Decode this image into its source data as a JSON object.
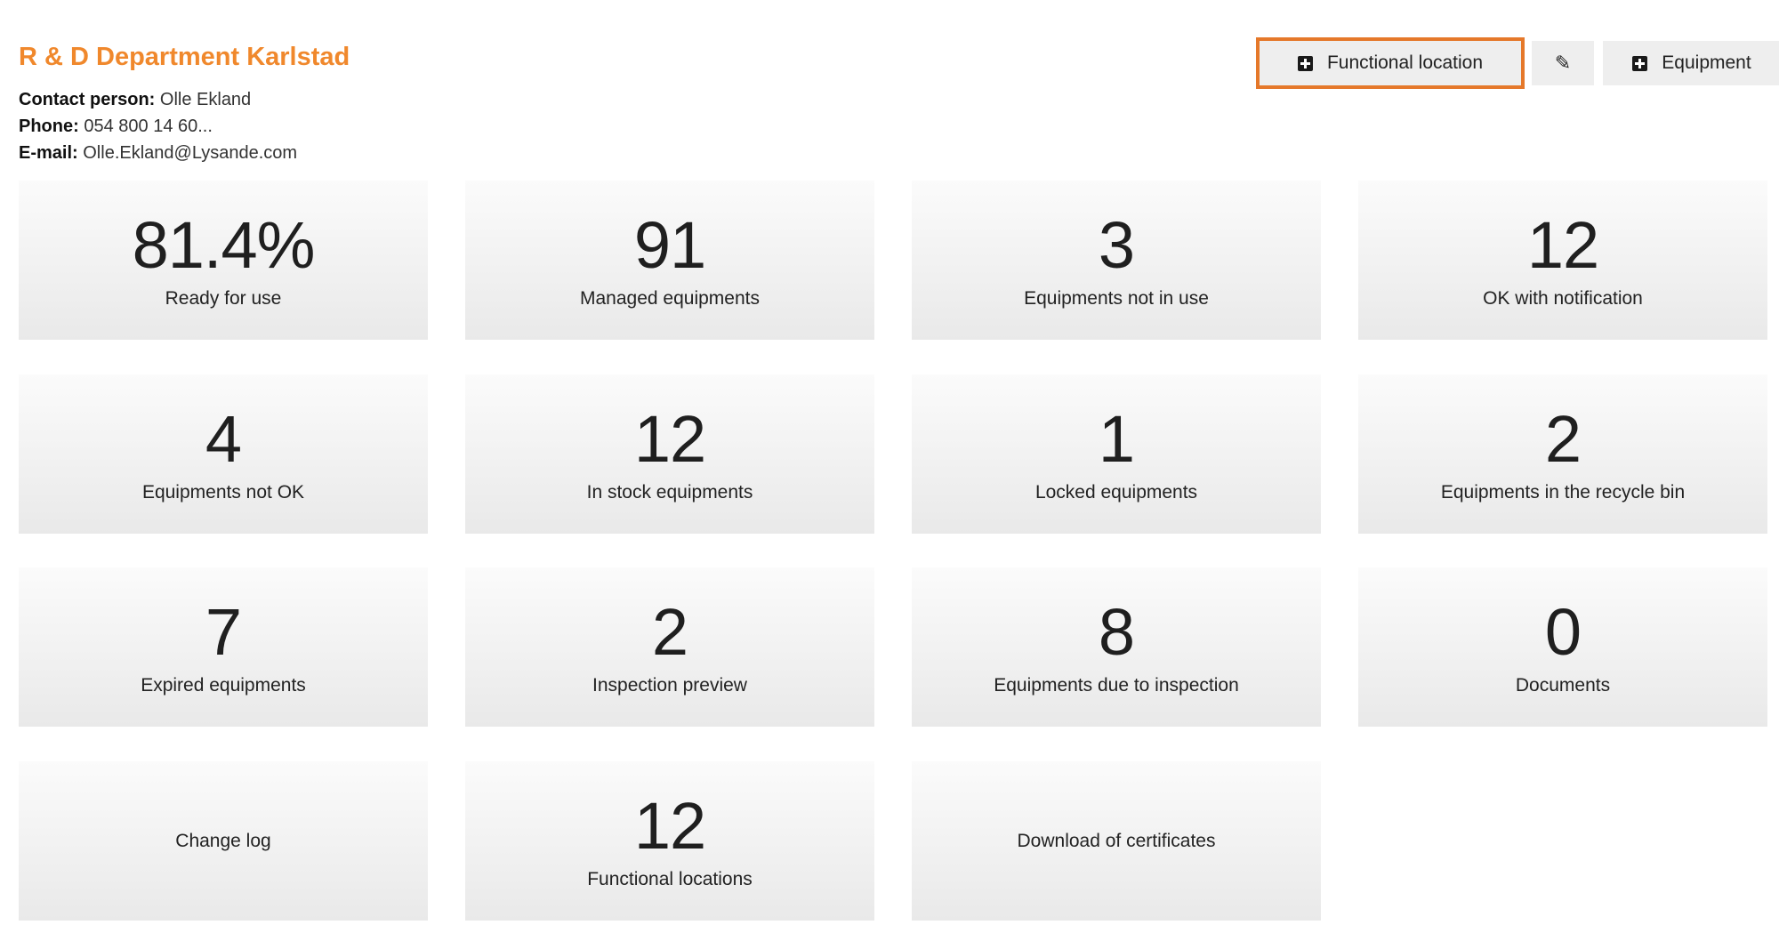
{
  "header": {
    "title": "R & D Department Karlstad",
    "contact_label": "Contact person:",
    "contact_value": "Olle Ekland",
    "phone_label": "Phone:",
    "phone_value": "054 800 14 60...",
    "email_label": "E-mail:",
    "email_value": "Olle.Ekland@Lysande.com"
  },
  "toolbar": {
    "functional_location_label": "Functional location",
    "functional_location_icon": "plus-square-icon",
    "edit_icon": "pencil-icon",
    "equipment_label": "Equipment",
    "equipment_icon": "plus-square-icon",
    "highlight_color": "#e5782a"
  },
  "tiles": [
    {
      "value": "81.4%",
      "label": "Ready for use"
    },
    {
      "value": "91",
      "label": "Managed equipments"
    },
    {
      "value": "3",
      "label": "Equipments not in use"
    },
    {
      "value": "12",
      "label": "OK with notification"
    },
    {
      "value": "4",
      "label": "Equipments not OK"
    },
    {
      "value": "12",
      "label": "In stock equipments"
    },
    {
      "value": "1",
      "label": "Locked equipments"
    },
    {
      "value": "2",
      "label": "Equipments in the recycle bin"
    },
    {
      "value": "7",
      "label": "Expired equipments"
    },
    {
      "value": "2",
      "label": "Inspection preview"
    },
    {
      "value": "8",
      "label": "Equipments due to inspection"
    },
    {
      "value": "0",
      "label": "Documents"
    },
    {
      "value": "",
      "label": "Change log"
    },
    {
      "value": "12",
      "label": "Functional locations"
    },
    {
      "value": "",
      "label": "Download of certificates"
    }
  ],
  "colors": {
    "accent": "#f0882c",
    "tile_top": "#fbfbfb",
    "tile_bottom": "#e9e9e9",
    "button_bg": "#eeeeee"
  }
}
